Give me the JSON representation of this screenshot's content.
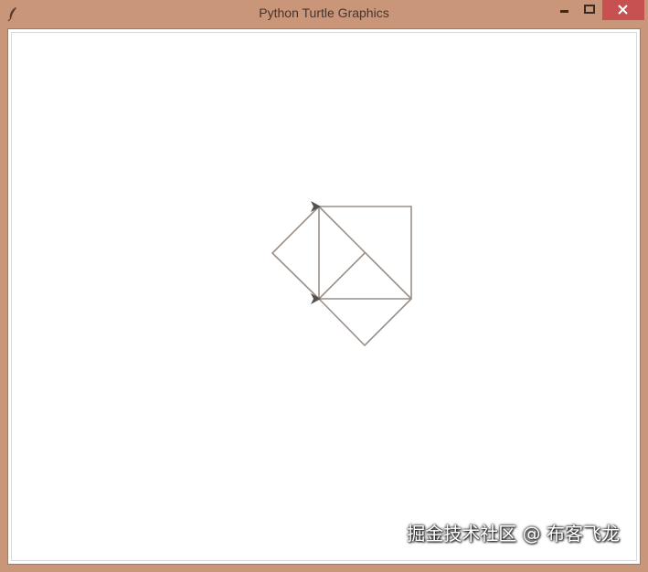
{
  "window": {
    "title": "Python Turtle Graphics",
    "frame_color": "#c99679",
    "close_color": "#c75050"
  },
  "icons": {
    "app": "feather-icon",
    "minimize": "minimize-icon",
    "maximize": "maximize-icon",
    "close": "close-icon"
  },
  "canvas": {
    "background": "#ffffff",
    "line_color": "#9a9088"
  },
  "watermark": {
    "text": "掘金技术社区 @ 布客飞龙"
  }
}
